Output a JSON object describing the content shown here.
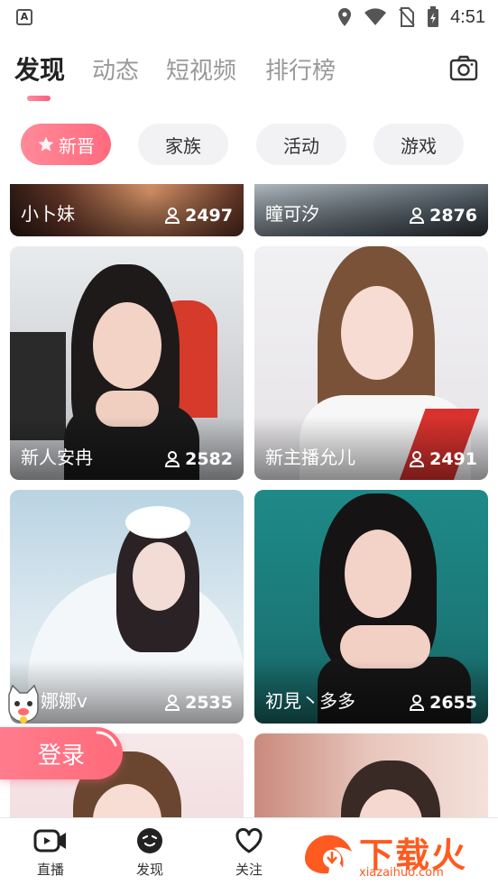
{
  "status_bar": {
    "time": "4:51"
  },
  "top_tabs": [
    {
      "label": "发现",
      "active": true
    },
    {
      "label": "动态",
      "active": false
    },
    {
      "label": "短视频",
      "active": false
    },
    {
      "label": "排行榜",
      "active": false
    }
  ],
  "filter_chips": [
    {
      "label": "新晋",
      "active": true
    },
    {
      "label": "家族",
      "active": false
    },
    {
      "label": "活动",
      "active": false
    },
    {
      "label": "游戏",
      "active": false
    }
  ],
  "streamers": [
    {
      "name": "小卜妹",
      "viewers": "2497"
    },
    {
      "name": "瞳可汐",
      "viewers": "2876"
    },
    {
      "name": "新人安冉",
      "viewers": "2582"
    },
    {
      "name": "新主播允儿",
      "viewers": "2491"
    },
    {
      "name": "娜娜v",
      "viewers": "2535"
    },
    {
      "name": "初見丶多多",
      "viewers": "2655"
    }
  ],
  "login_button": "登录",
  "bottom_nav": [
    {
      "label": "直播",
      "icon": "live-video-icon"
    },
    {
      "label": "发现",
      "icon": "discover-face-icon"
    },
    {
      "label": "关注",
      "icon": "heart-icon"
    }
  ],
  "watermark": {
    "title": "下载火",
    "url": "xiazaihuo.com"
  },
  "colors": {
    "accent": "#ff6b7e",
    "chip_bg": "#f2f2f4",
    "watermark": "#ff5a1f"
  }
}
